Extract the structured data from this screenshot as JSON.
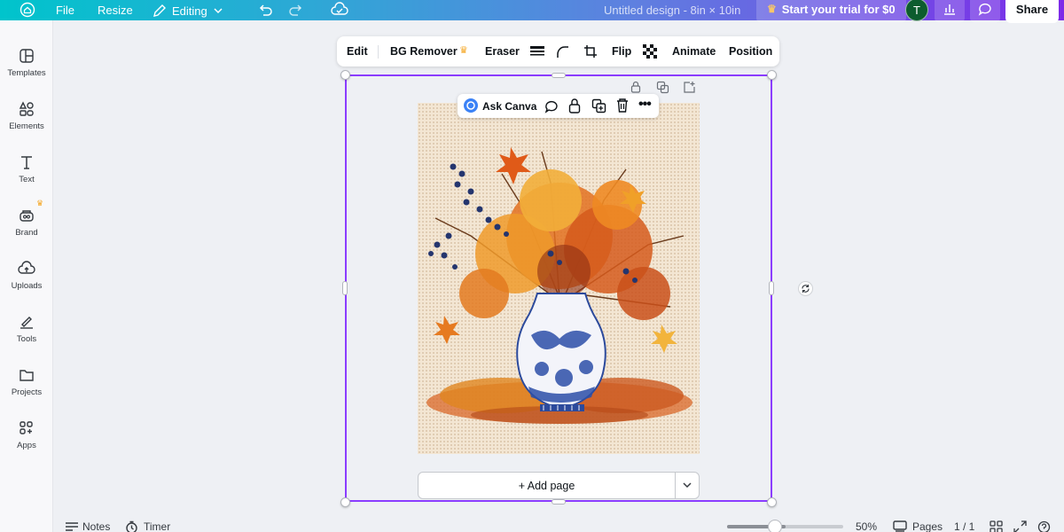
{
  "topbar": {
    "file": "File",
    "resize": "Resize",
    "mode": "Editing",
    "doc_title": "Untitled design - 8in × 10in",
    "trial": "Start your trial for $0",
    "avatar_initial": "T",
    "share": "Share"
  },
  "sidebar": {
    "items": [
      {
        "label": "Templates",
        "icon": "templates-icon"
      },
      {
        "label": "Elements",
        "icon": "elements-icon"
      },
      {
        "label": "Text",
        "icon": "text-icon"
      },
      {
        "label": "Brand",
        "icon": "brand-icon"
      },
      {
        "label": "Uploads",
        "icon": "uploads-icon"
      },
      {
        "label": "Tools",
        "icon": "tools-icon"
      },
      {
        "label": "Projects",
        "icon": "projects-icon"
      },
      {
        "label": "Apps",
        "icon": "apps-icon"
      }
    ]
  },
  "context_toolbar": {
    "edit": "Edit",
    "bg_remover": "BG Remover",
    "eraser": "Eraser",
    "flip": "Flip",
    "animate": "Animate",
    "position": "Position"
  },
  "element_toolbar": {
    "ask": "Ask Canva"
  },
  "canvas": {
    "add_page": "+ Add page"
  },
  "bottom": {
    "notes": "Notes",
    "timer": "Timer",
    "zoom": "50%",
    "zoom_fraction": 0.5,
    "pages": "Pages",
    "page_count": "1 / 1"
  },
  "colors": {
    "accent": "#8b3dff",
    "brand_gradient_start": "#00c4cc",
    "brand_gradient_end": "#7d2ae8",
    "crown": "#f5a623"
  }
}
